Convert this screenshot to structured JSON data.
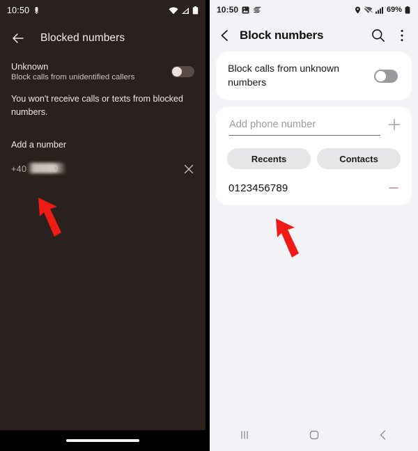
{
  "left_phone": {
    "platform_theme": "dark",
    "status_bar": {
      "time": "10:50",
      "icons": [
        "vibrate-icon",
        "wifi-icon",
        "signal-icon",
        "battery-icon"
      ]
    },
    "app_bar": {
      "back_label": "back-arrow",
      "title": "Blocked numbers"
    },
    "unknown_row": {
      "title": "Unknown",
      "subtitle": "Block calls from unidentified callers",
      "toggle_state": "off"
    },
    "note": "You won't receive calls or texts from blocked numbers.",
    "add_label": "Add a number",
    "blocked_entry": {
      "prefix": "+40",
      "redacted": true,
      "suffix": "0",
      "remove_label": "remove"
    },
    "gesture_bar": true
  },
  "right_phone": {
    "platform_theme": "light",
    "status_bar": {
      "time": "10:50",
      "battery_percent": "69%",
      "icons": [
        "screenshot-icon",
        "data-transfer-icon",
        "location-icon",
        "wifi-icon",
        "signal-icon",
        "battery-icon"
      ]
    },
    "app_bar": {
      "back_label": "back-chevron",
      "title": "Block numbers",
      "search_label": "search",
      "more_label": "more-options"
    },
    "unknown_card": {
      "label": "Block calls from unknown numbers",
      "toggle_state": "off"
    },
    "add_input": {
      "value": "",
      "placeholder": "Add phone number",
      "add_button_label": "add"
    },
    "chips": [
      {
        "label": "Recents"
      },
      {
        "label": "Contacts"
      }
    ],
    "blocked_list": [
      {
        "number": "0123456789",
        "remove_label": "remove"
      }
    ],
    "nav_bar": {
      "recents_label": "recents",
      "home_label": "home",
      "back_label": "back"
    }
  },
  "annotations": {
    "accent_color": "#ee1b16",
    "arrows": [
      {
        "name": "arrow-left-panel",
        "target": "blocked-number-entry"
      },
      {
        "name": "arrow-right-panel",
        "target": "blocked-number-entry"
      }
    ]
  },
  "colors": {
    "left_background": "#2a201d",
    "right_background": "#f3f3f7",
    "card_background": "#ffffff",
    "chip_background": "#e6e6e9",
    "remove_accent": "#c08b89"
  }
}
